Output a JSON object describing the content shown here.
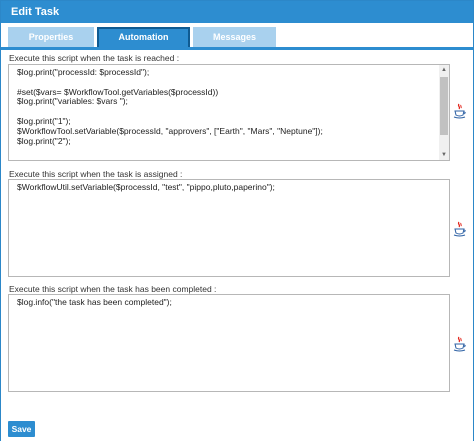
{
  "window": {
    "title": "Edit Task"
  },
  "tabs": [
    {
      "label": "Properties",
      "active": false
    },
    {
      "label": "Automation",
      "active": true
    },
    {
      "label": "Messages",
      "active": false
    }
  ],
  "sections": {
    "reached": {
      "label": "Execute this script when the task is reached :",
      "lines": [
        "$log.print(\"processId: $processId\");",
        "",
        "#set($vars= $WorkflowTool.getVariables($processId))",
        "$log.print(\"variables: $vars \");",
        "",
        "$log.print(\"1\");",
        "$WorkflowTool.setVariable($processId, \"approvers\", [\"Earth\", \"Mars\", \"Neptune\"]);",
        "$log.print(\"2\");"
      ]
    },
    "assigned": {
      "label": "Execute this script when the task is assigned :",
      "lines": [
        "$WorkflowUtil.setVariable($processId, \"test\", \"pippo,pluto,paperino\");"
      ]
    },
    "completed": {
      "label": "Execute this script when the task has been completed :",
      "lines": [
        "$log.info(\"the task has been completed\");"
      ]
    }
  },
  "icons": {
    "script_editor": "java-cup-icon"
  },
  "footer": {
    "save_label": "Save"
  },
  "colors": {
    "accent": "#2d8dd0",
    "tab_inactive": "#a9d1ee",
    "tab_active_border": "#0f5b92"
  }
}
